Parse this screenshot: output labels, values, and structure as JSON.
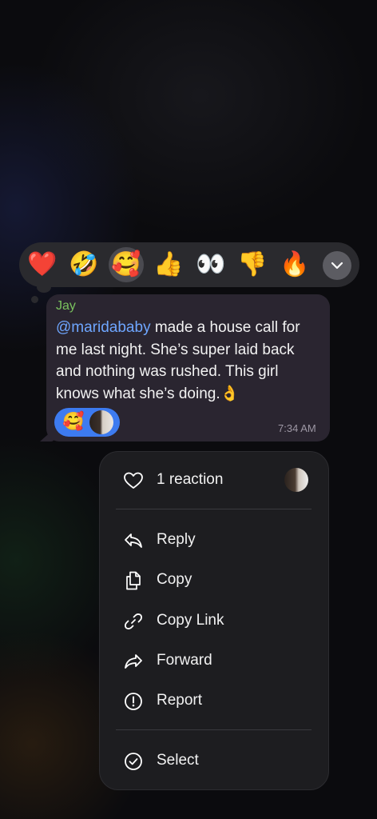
{
  "reactions": {
    "emojis": [
      {
        "glyph": "❤️",
        "name": "heart"
      },
      {
        "glyph": "🤣",
        "name": "rofl"
      },
      {
        "glyph": "🥰",
        "name": "smiling-hearts",
        "selected": true
      },
      {
        "glyph": "👍",
        "name": "thumbs-up"
      },
      {
        "glyph": "👀",
        "name": "eyes"
      },
      {
        "glyph": "👎",
        "name": "thumbs-down"
      },
      {
        "glyph": "🔥",
        "name": "fire"
      }
    ],
    "more_icon": "chevron-down-icon"
  },
  "message": {
    "sender": "Jay",
    "mention": "@maridababy",
    "text": " made a house call for me last night. She’s super laid back and nothing was rushed. This girl knows what she’s doing.👌",
    "reaction_chip_emoji": "🥰",
    "time": "7:34 AM",
    "colors": {
      "sender": "#7ac35e",
      "mention": "#6ea6ff",
      "chip": "#3d7bf0"
    }
  },
  "menu": {
    "reactions_label": "1 reaction",
    "items": [
      {
        "label": "Reply",
        "icon": "reply-icon"
      },
      {
        "label": "Copy",
        "icon": "copy-icon"
      },
      {
        "label": "Copy Link",
        "icon": "link-icon"
      },
      {
        "label": "Forward",
        "icon": "forward-icon"
      },
      {
        "label": "Report",
        "icon": "report-icon"
      }
    ],
    "select_label": "Select"
  }
}
